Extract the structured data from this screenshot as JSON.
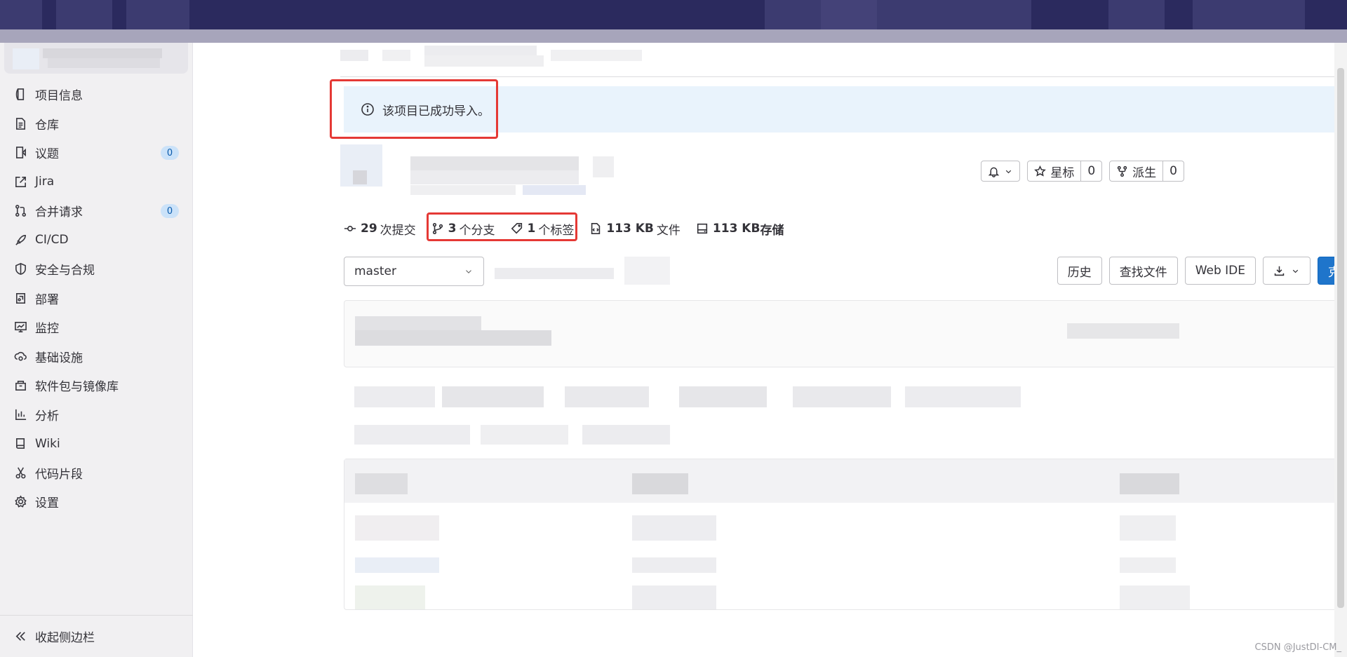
{
  "sidebar": {
    "items": [
      {
        "label": "项目信息",
        "icon": "project-icon",
        "count": null
      },
      {
        "label": "仓库",
        "icon": "repository-icon",
        "count": null
      },
      {
        "label": "议题",
        "icon": "issues-icon",
        "count": "0"
      },
      {
        "label": "Jira",
        "icon": "external-link-icon",
        "count": null
      },
      {
        "label": "合并请求",
        "icon": "merge-request-icon",
        "count": "0"
      },
      {
        "label": "CI/CD",
        "icon": "rocket-icon",
        "count": null
      },
      {
        "label": "安全与合规",
        "icon": "shield-icon",
        "count": null
      },
      {
        "label": "部署",
        "icon": "deployments-icon",
        "count": null
      },
      {
        "label": "监控",
        "icon": "monitor-icon",
        "count": null
      },
      {
        "label": "基础设施",
        "icon": "cloud-gear-icon",
        "count": null
      },
      {
        "label": "软件包与镜像库",
        "icon": "package-icon",
        "count": null
      },
      {
        "label": "分析",
        "icon": "chart-icon",
        "count": null
      },
      {
        "label": "Wiki",
        "icon": "book-icon",
        "count": null
      },
      {
        "label": "代码片段",
        "icon": "scissors-icon",
        "count": null
      },
      {
        "label": "设置",
        "icon": "settings-icon",
        "count": null
      }
    ],
    "collapse_label": "收起侧边栏"
  },
  "alert": {
    "message": "该项目已成功导入。"
  },
  "project_actions": {
    "star_label": "星标",
    "star_count": "0",
    "fork_label": "派生",
    "fork_count": "0"
  },
  "stats": {
    "commits_num": "29",
    "commits_label": "次提交",
    "branches_num": "3",
    "branches_label": "个分支",
    "tags_num": "1",
    "tags_label": "个标签",
    "files_num": "113 KB",
    "files_label": "文件",
    "storage_num": "113 KB",
    "storage_label": "存储"
  },
  "toolbar": {
    "branch": "master",
    "history_label": "历史",
    "find_file_label": "查找文件",
    "web_ide_label": "Web IDE",
    "clone_label": "克隆"
  },
  "watermark": "CSDN @JustDI-CM_",
  "colors": {
    "accent": "#1f75cb",
    "highlight_border": "#e53935",
    "alert_bg": "#e9f3fc",
    "header_bg": "#2b2a5e"
  }
}
